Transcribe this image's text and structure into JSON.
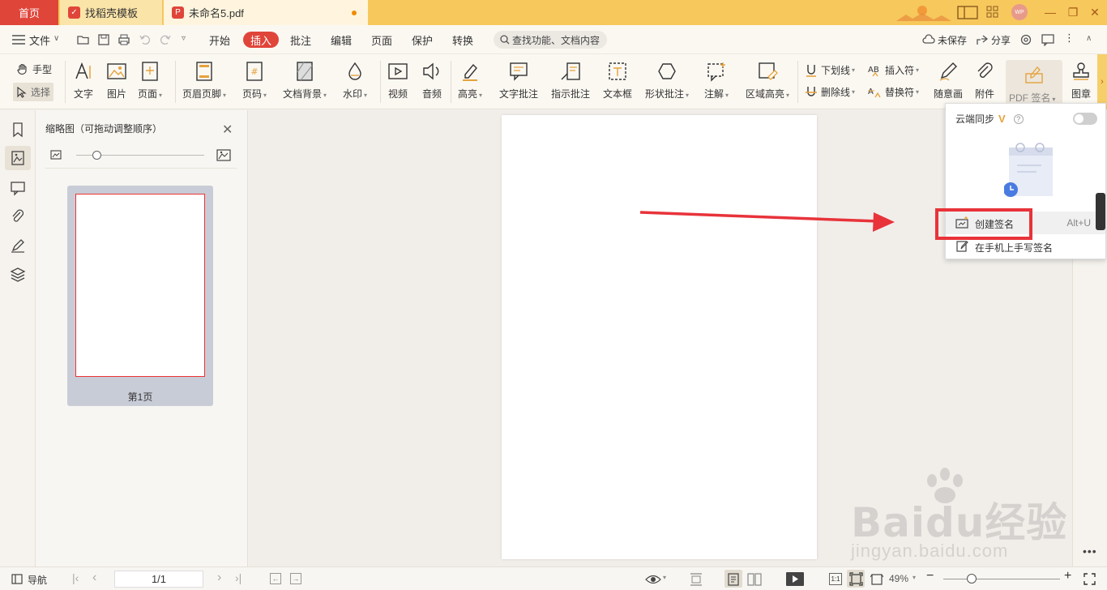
{
  "tabs": {
    "home": "首页",
    "template": "找稻壳模板",
    "file": "未命名5.pdf",
    "add": "+"
  },
  "menu": {
    "file": "文件",
    "items": [
      "开始",
      "插入",
      "批注",
      "编辑",
      "页面",
      "保护",
      "转换"
    ],
    "search_placeholder": "查找功能、文档内容",
    "unsaved": "未保存",
    "share": "分享"
  },
  "ribbon": {
    "hand": "手型",
    "select": "选择",
    "text": "文字",
    "image": "图片",
    "page": "页面",
    "header_footer": "页眉页脚",
    "page_number": "页码",
    "background": "文档背景",
    "watermark": "水印",
    "video": "视频",
    "audio": "音频",
    "highlight": "高亮",
    "text_comment": "文字批注",
    "pointer_comment": "指示批注",
    "textbox": "文本框",
    "shape_comment": "形状批注",
    "annotation": "注解",
    "area_highlight": "区域高亮",
    "underline": "下划线",
    "strikethrough": "删除线",
    "insert_symbol": "插入符",
    "replace_symbol": "替换符",
    "freehand": "随意画",
    "attachment": "附件",
    "pdf_sign": "PDF 签名",
    "stamp": "图章"
  },
  "thumbnail": {
    "title": "缩略图（可拖动调整顺序）",
    "page_label": "第1页"
  },
  "dropdown": {
    "cloud_sync": "云端同步",
    "create_signature": "创建签名",
    "shortcut": "Alt+U",
    "phone_signature": "在手机上手写签名"
  },
  "status": {
    "nav": "导航",
    "page_value": "1/1",
    "zoom": "49%"
  },
  "watermark": {
    "brand": "Baidu经验",
    "url": "jingyan.baidu.com"
  },
  "colors": {
    "accent": "#e0453a",
    "tabbar": "#f7c85c",
    "highlight_box": "#e8333a",
    "arrow": "#e8333a"
  }
}
